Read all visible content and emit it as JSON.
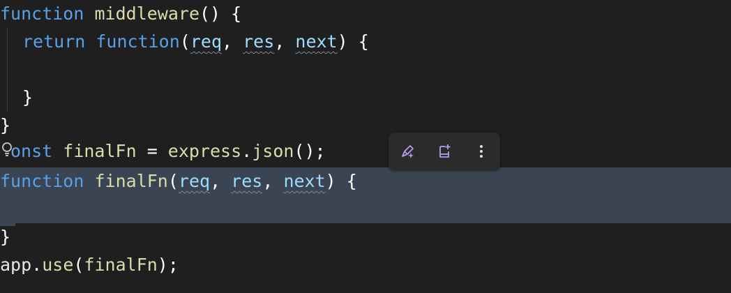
{
  "code": {
    "l1": {
      "kw": "function",
      "name": "middleware",
      "rest": "() {"
    },
    "l2": {
      "kw": "return",
      "fn": "function",
      "open": "(",
      "p1": "req",
      "c1": ", ",
      "p2": "res",
      "c2": ", ",
      "p3": "next",
      "close": ") {"
    },
    "l4": {
      "brace": "}"
    },
    "l5": {
      "brace": "}"
    },
    "l6": {
      "kw_rest": "onst",
      "name": "finalFn",
      "eq": " = ",
      "obj": "express",
      "dot": ".",
      "call": "json",
      "tail": "();"
    },
    "l7": {
      "kw": "function",
      "name": "finalFn",
      "open": "(",
      "p1": "req",
      "c1": ", ",
      "p2": "res",
      "c2": ", ",
      "p3": "next",
      "close": ") {"
    },
    "l9": {
      "brace": "}"
    },
    "l10": {
      "obj": "app",
      "dot": ".",
      "call": "use",
      "open": "(",
      "arg": "finalFn",
      "close": ");"
    }
  },
  "toolbar": {
    "icons": [
      "edit-sparkle-icon",
      "bookmark-add-icon",
      "more-vertical-icon"
    ]
  },
  "colors": {
    "background": "#1f1f1f",
    "selection": "#3a4452",
    "keyword": "#5aa0e6",
    "function": "#dcdcaa",
    "parameter": "#9cdcfe",
    "toolbar_bg": "#2b2b2b"
  }
}
